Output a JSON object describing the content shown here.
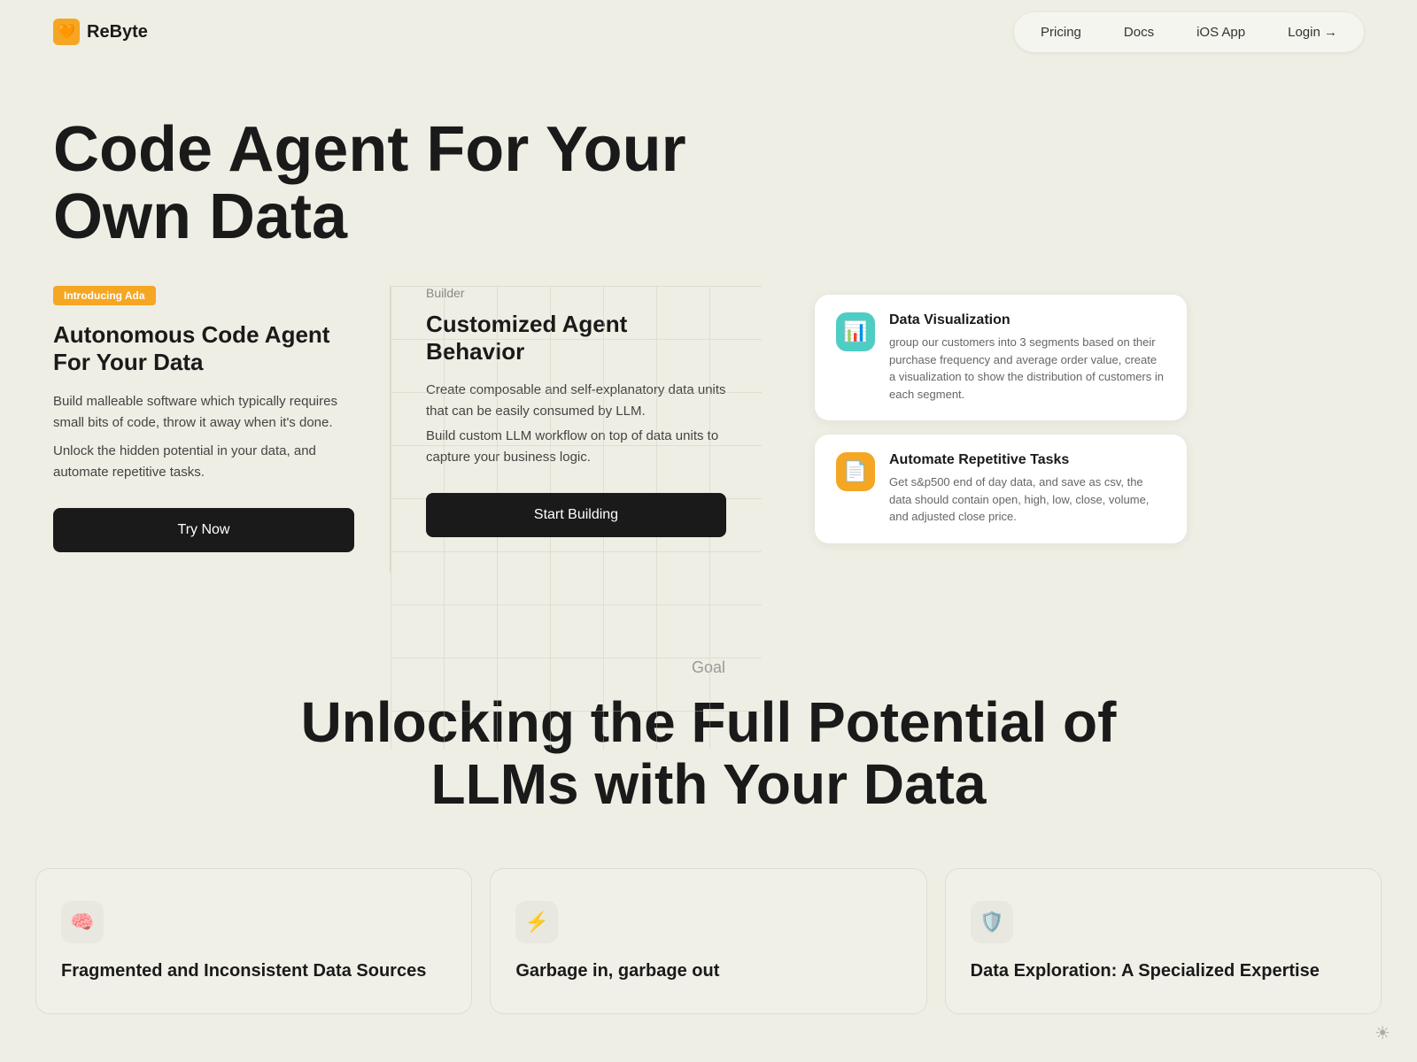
{
  "navbar": {
    "logo_text": "ReByte",
    "links": [
      {
        "label": "Pricing",
        "id": "pricing"
      },
      {
        "label": "Docs",
        "id": "docs"
      },
      {
        "label": "iOS App",
        "id": "ios-app"
      }
    ],
    "login_label": "Login →"
  },
  "hero": {
    "title": "Code Agent For Your Own Data",
    "left_card": {
      "badge": "Introducing Ada",
      "title": "Autonomous Code Agent For Your Data",
      "desc1": "Build malleable software which typically requires small bits of code, throw it away when it's done.",
      "desc2": "Unlock the hidden potential in your data, and automate repetitive tasks.",
      "button_label": "Try Now"
    },
    "middle_card": {
      "label": "Builder",
      "title": "Customized Agent Behavior",
      "desc1": "Create composable and self-explanatory data units that can be easily consumed by LLM.",
      "desc2": "Build custom LLM workflow on top of data units to capture your business logic.",
      "button_label": "Start Building"
    },
    "right_cards": [
      {
        "icon": "📊",
        "icon_style": "teal",
        "title": "Data Visualization",
        "desc": "group our customers into 3 segments based on their purchase frequency and average order value, create a visualization to show the distribution of customers in each segment."
      },
      {
        "icon": "📄",
        "icon_style": "orange",
        "title": "Automate Repetitive Tasks",
        "desc": "Get s&p500 end of day data, and save as csv, the data should contain open, high, low, close, volume, and adjusted close price."
      }
    ]
  },
  "goal": {
    "label": "Goal",
    "title": "Unlocking the Full Potential of LLMs with Your Data"
  },
  "bottom_cards": [
    {
      "icon": "🧠",
      "title": "Fragmented and Inconsistent Data Sources"
    },
    {
      "icon": "⚡",
      "title": "Garbage in, garbage out"
    },
    {
      "icon": "🛡️",
      "title": "Data Exploration: A Specialized Expertise"
    }
  ]
}
